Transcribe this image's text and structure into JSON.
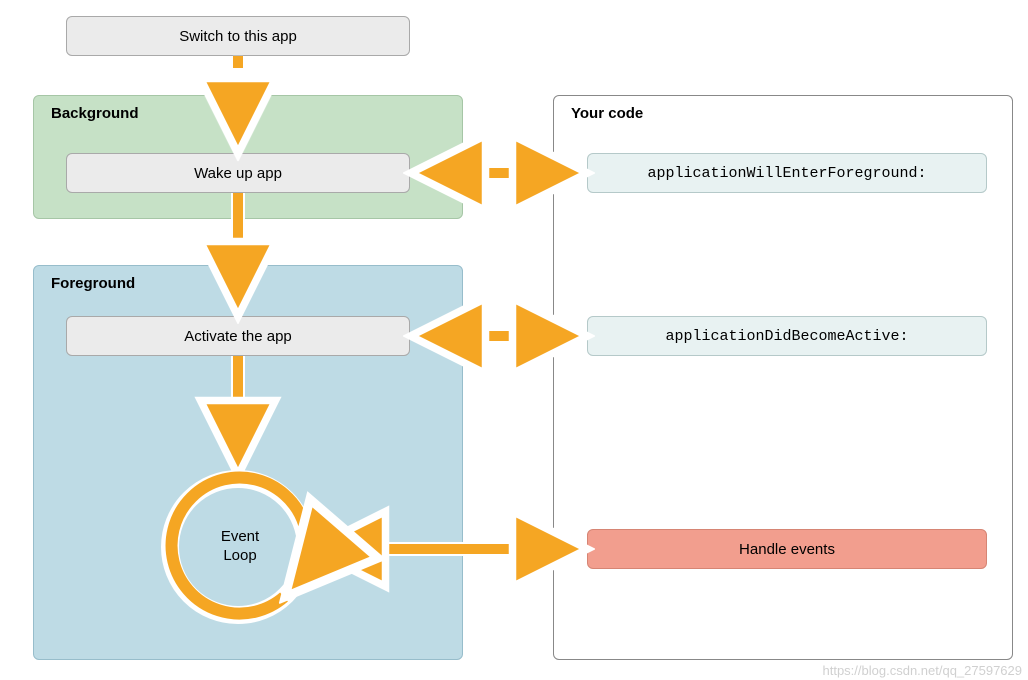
{
  "start_node": "Switch to this app",
  "background": {
    "title": "Background",
    "wake": "Wake up app"
  },
  "foreground": {
    "title": "Foreground",
    "activate": "Activate the app",
    "event_loop": "Event\nLoop"
  },
  "your_code": {
    "title": "Your code",
    "enter_fg": "applicationWillEnterForeground:",
    "become_active": "applicationDidBecomeActive:",
    "handle_events": "Handle events"
  },
  "watermark": "https://blog.csdn.net/qq_27597629",
  "colors": {
    "arrow": "#f5a623",
    "arrow_outline": "#ffffff",
    "bg_panel": "#c6e1c6",
    "fg_panel": "#bedbe5",
    "node_gray": "#ebebeb",
    "node_code": "#e8f2f2",
    "node_red": "#f29e8e"
  }
}
